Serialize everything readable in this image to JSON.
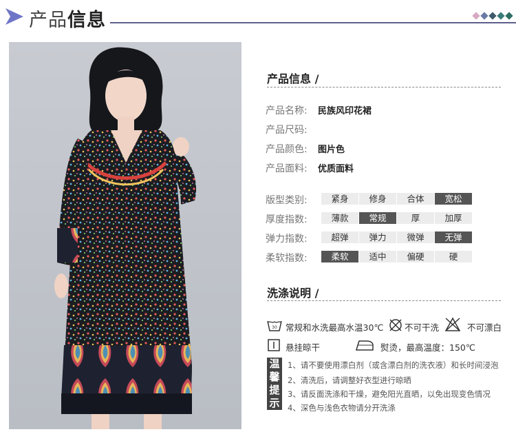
{
  "header": {
    "title_light": "产品",
    "title_bold": "信息"
  },
  "colors": {
    "rule": "#5b5f8a",
    "arrow": "#6f76c7",
    "diamonds": [
      "#d7a9c0",
      "#6b7aa6",
      "#3e5a6b",
      "#3a7c78",
      "#2e6e62"
    ]
  },
  "product_info": {
    "section_title": "产品信息 /",
    "rows": [
      {
        "label": "产品名称:",
        "value": "民族风印花裙"
      },
      {
        "label": "产品尺码:",
        "value": ""
      },
      {
        "label": "产品颜色:",
        "value": "图片色"
      },
      {
        "label": "产品面料:",
        "value": "优质面料"
      }
    ]
  },
  "attributes": [
    {
      "label": "版型类别:",
      "options": [
        "紧身",
        "修身",
        "合体",
        "宽松"
      ],
      "selected": 3
    },
    {
      "label": "厚度指数:",
      "options": [
        "薄款",
        "常规",
        "厚",
        "加厚"
      ],
      "selected": 1
    },
    {
      "label": "弹力指数:",
      "options": [
        "超弹",
        "弹力",
        "微弹",
        "无弹"
      ],
      "selected": 3
    },
    {
      "label": "柔软指数:",
      "options": [
        "柔软",
        "适中",
        "偏硬",
        "硬"
      ],
      "selected": 0
    }
  ],
  "washing": {
    "section_title": "洗涤说明 /",
    "items": [
      {
        "icon": "wash-30-icon",
        "text": "常规和水洗最高水温30℃"
      },
      {
        "icon": "no-dry-clean-icon",
        "text": "不可干洗"
      },
      {
        "icon": "no-bleach-icon",
        "text": "不可漂白"
      },
      {
        "icon": "hang-dry-icon",
        "text": "悬挂晾干"
      },
      {
        "icon": "iron-icon",
        "text": "熨烫，最高温度：150℃"
      }
    ],
    "iron_dots": "..."
  },
  "tips": {
    "box_label": "温馨提示",
    "items": [
      "1、请不要使用漂白剂（或含漂白剂的洗衣液）和长时间浸泡",
      "2、清洗后，请调整好衣型进行晾晒",
      "3、请反面洗涤和干燥，避免阳光直晒，以免出现变色情况",
      "4、深色与浅色衣物请分开洗涤"
    ]
  }
}
